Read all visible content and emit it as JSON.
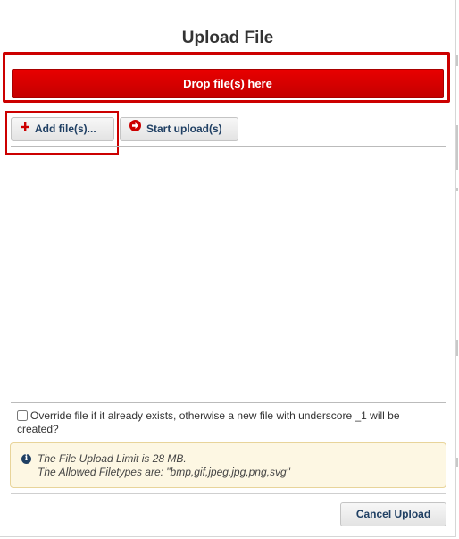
{
  "dialog": {
    "title": "Upload File"
  },
  "drop_zone": {
    "label": "Drop file(s) here"
  },
  "toolbar": {
    "add_label": "Add file(s)...",
    "start_label": "Start upload(s)"
  },
  "override": {
    "checked": false,
    "label": "Override file if it already exists, otherwise a new file with underscore _1 will be created?"
  },
  "info": {
    "limit_text": "The File Upload Limit is 28 MB.",
    "filetypes_text": "The Allowed Filetypes are: \"bmp,gif,jpeg,jpg,png,svg\""
  },
  "footer": {
    "cancel_label": "Cancel Upload"
  },
  "icons": {
    "add": "plus-icon",
    "start": "arrow-circle-right-icon",
    "info": "info-circle-icon"
  },
  "colors": {
    "accent_red": "#cc0000",
    "text_navy": "#1f3f63",
    "info_bg": "#fdf7e3"
  }
}
